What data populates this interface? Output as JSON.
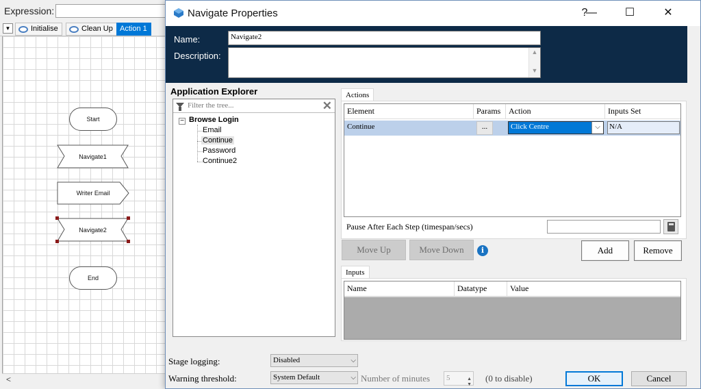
{
  "background_app": {
    "expression_label": "Expression:",
    "tabs": [
      "Initialise",
      "Clean Up",
      "Action 1"
    ],
    "stages": [
      "Start",
      "Navigate1",
      "Writer Email",
      "Navigate2",
      "End"
    ],
    "scroll_left_glyph": "<"
  },
  "dialog": {
    "title": "Navigate Properties",
    "title_buttons": {
      "help": "?",
      "minimize": "—",
      "maximize": "☐",
      "close": "✕"
    },
    "name_label": "Name:",
    "name_value": "Navigate2",
    "description_label": "Description:",
    "description_value": "",
    "app_explorer": {
      "title": "Application Explorer",
      "filter_placeholder": "Filter the tree...",
      "root": "Browse Login",
      "children": [
        "Email",
        "Continue",
        "Password",
        "Continue2"
      ],
      "selected": "Continue"
    },
    "actions": {
      "tab_label": "Actions",
      "columns": [
        "Element",
        "Params",
        "Action",
        "Inputs Set"
      ],
      "rows": [
        {
          "element": "Continue",
          "params": "...",
          "action": "Click Centre",
          "inputs_set": "N/A"
        }
      ],
      "pause_label": "Pause After Each Step (timespan/secs)",
      "pause_value": "",
      "move_up": "Move Up",
      "move_down": "Move Down",
      "add": "Add",
      "remove": "Remove"
    },
    "inputs": {
      "tab_label": "Inputs",
      "columns": [
        "Name",
        "Datatype",
        "Value"
      ]
    },
    "footer": {
      "stage_logging_label": "Stage logging:",
      "stage_logging_value": "Disabled",
      "warning_threshold_label": "Warning threshold:",
      "warning_threshold_value": "System Default",
      "minutes_label": "Number of minutes",
      "minutes_value": "5",
      "zero_to_disable": "(0 to disable)",
      "ok": "OK",
      "cancel": "Cancel"
    }
  },
  "colors": {
    "header_bg": "#0d2a47",
    "accent": "#0078d7",
    "selected_row": "#bcd0ea"
  }
}
